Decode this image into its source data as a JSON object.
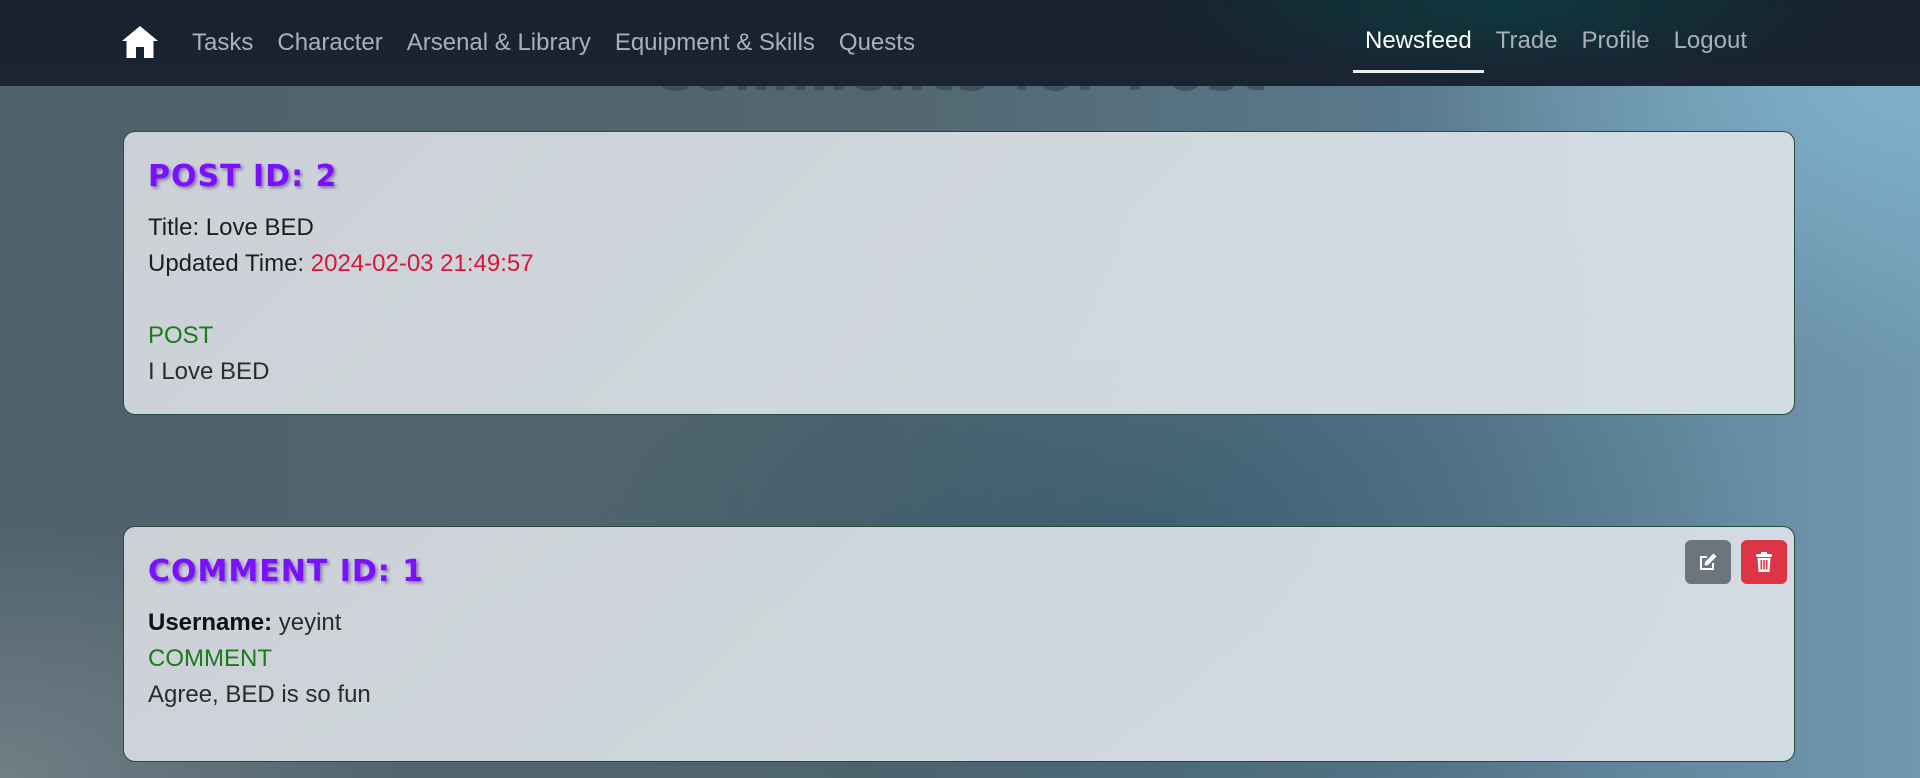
{
  "nav": {
    "home_icon": "home-icon",
    "left_links": [
      "Tasks",
      "Character",
      "Arsenal & Library",
      "Equipment & Skills",
      "Quests"
    ],
    "right_links": [
      "Newsfeed",
      "Trade",
      "Profile",
      "Logout"
    ],
    "active": "Newsfeed"
  },
  "page_heading": "Comments for Post",
  "post": {
    "title_label": "POST ID: 2",
    "title_prefix": "Title: ",
    "title_value": "Love BED",
    "updated_prefix": "Updated Time: ",
    "updated_value": "2024-02-03 21:49:57",
    "section_label": "POST",
    "content": "I Love BED"
  },
  "comment": {
    "title_label": "COMMENT ID: 1",
    "username_label": "Username:",
    "username_value": "yeyint",
    "section_label": "COMMENT",
    "content": "Agree, BED is so fun",
    "edit_icon": "edit-icon",
    "delete_icon": "trash-icon"
  },
  "colors": {
    "accent_purple": "#7a10ff",
    "time_red": "#dc143c",
    "label_green": "#1b7a1b",
    "edit_button": "#6c757d",
    "delete_button": "#dc3545"
  }
}
